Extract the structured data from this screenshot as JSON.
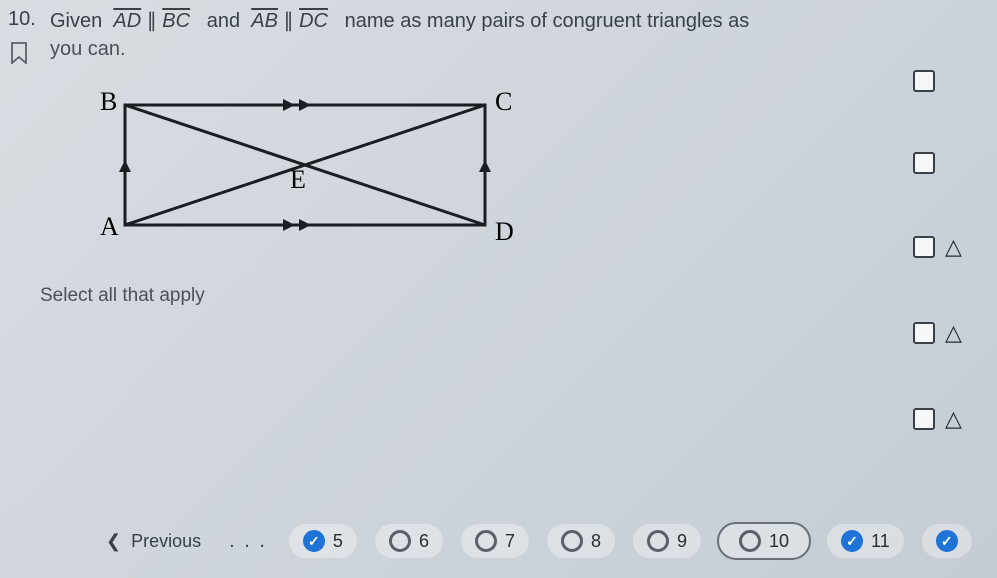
{
  "question": {
    "number": "10.",
    "prompt_prefix": "Given",
    "seg1a": "AD",
    "op": "∥",
    "seg1b": "BC",
    "and": "and",
    "seg2a": "AB",
    "seg2b": "DC",
    "prompt_suffix": "name as many pairs of congruent triangles as",
    "prompt_line2": "you can.",
    "select_all": "Select all that apply"
  },
  "diagram": {
    "B": "B",
    "C": "C",
    "A": "A",
    "D": "D",
    "E": "E"
  },
  "answers": {
    "tri_glyph": "△"
  },
  "nav": {
    "previous": "Previous",
    "dots": ". . .",
    "p5": "5",
    "p6": "6",
    "p7": "7",
    "p8": "8",
    "p9": "9",
    "p10": "10",
    "p11": "11",
    "check": "✓"
  }
}
